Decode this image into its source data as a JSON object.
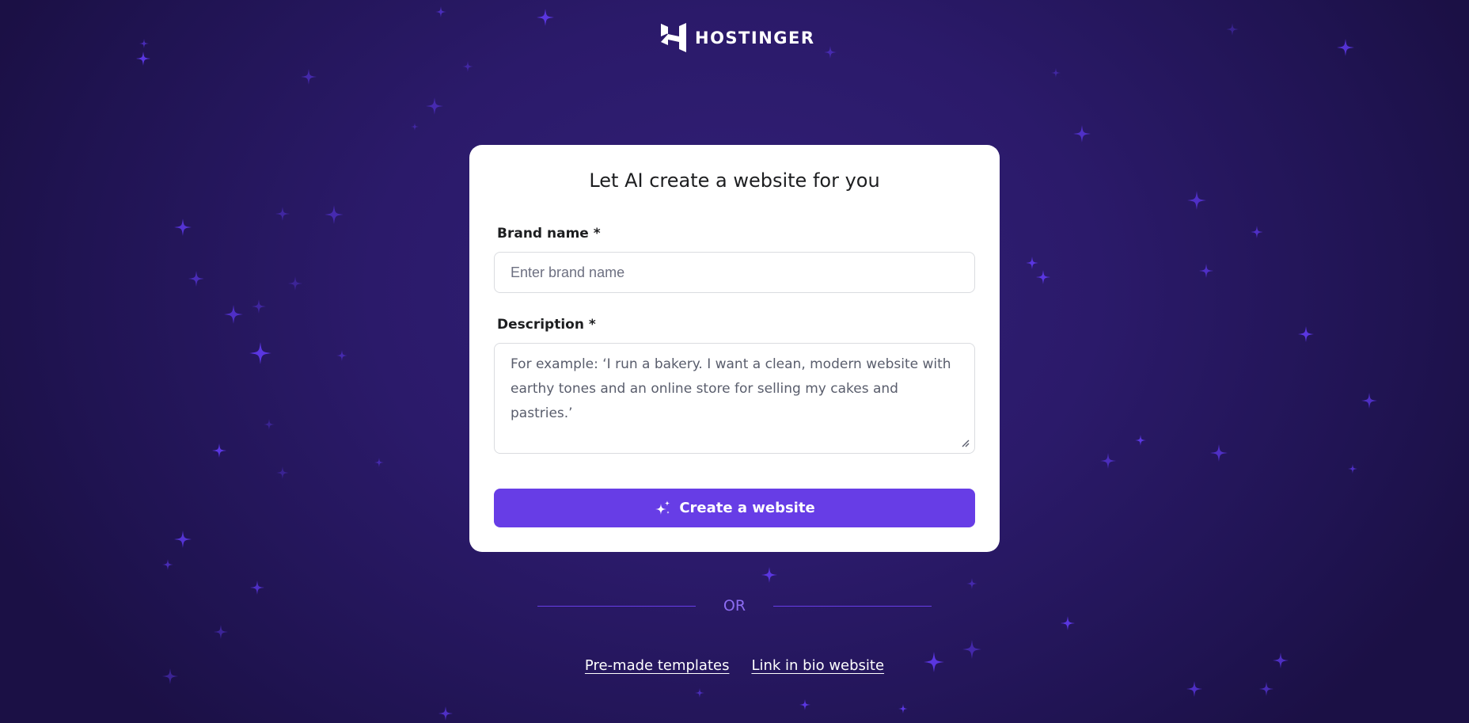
{
  "brand": {
    "name": "HOSTINGER",
    "logo_icon": "hostinger-h-icon"
  },
  "card": {
    "title": "Let AI create a website for you",
    "brand_field": {
      "label": "Brand name *",
      "value": "",
      "placeholder": "Enter brand name"
    },
    "description_field": {
      "label": "Description *",
      "value": "",
      "placeholder": "For example: ‘I run a bakery. I want a clean, modern website with earthy tones and an online store for selling my cakes and pastries.’"
    },
    "create_button": {
      "label": "Create a website",
      "icon": "sparkles-icon"
    }
  },
  "divider": {
    "text": "OR"
  },
  "links": {
    "templates": "Pre-made templates",
    "link_in_bio": "Link in bio website"
  },
  "colors": {
    "background": "#2b1a6a",
    "accent": "#673de6",
    "card": "#ffffff",
    "star": "#5e3ae6"
  }
}
